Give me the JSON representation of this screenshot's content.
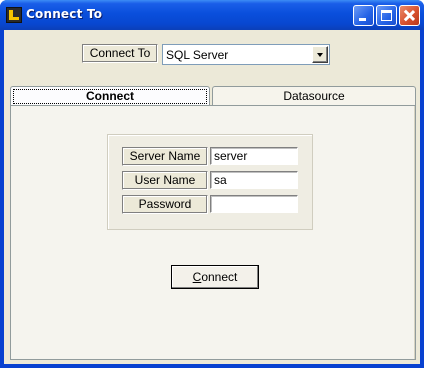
{
  "window": {
    "title": "Connect To"
  },
  "connect_to": {
    "label": "Connect To",
    "selected": "SQL Server"
  },
  "tabs": [
    {
      "label": "Connect",
      "active": true
    },
    {
      "label": "Datasource",
      "active": false
    }
  ],
  "fields": {
    "server": {
      "label": "Server Name",
      "value": "server"
    },
    "user": {
      "label": "User Name",
      "value": "sa"
    },
    "password": {
      "label": "Password",
      "value": ""
    }
  },
  "connect_button": {
    "mnemonic": "C",
    "rest": "onnect"
  },
  "colors": {
    "titlebar": "#0a4fdc",
    "dialog_face": "#ece9d8",
    "close_button": "#d8522e"
  }
}
